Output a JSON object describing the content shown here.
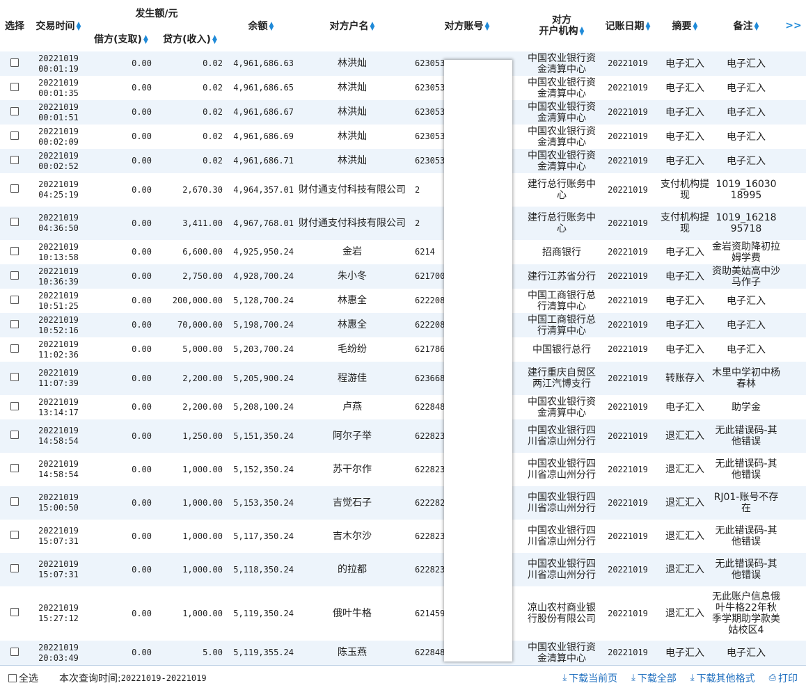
{
  "header": {
    "select": "选择",
    "time": "交易时间",
    "amount_group": "发生额/元",
    "debit": "借方(支取)",
    "credit": "贷方(收入)",
    "balance": "余额",
    "name": "对方户名",
    "account": "对方账号",
    "bank_line1": "对方",
    "bank_line2": "开户机构",
    "date": "记账日期",
    "summary": "摘要",
    "remark": "备注",
    "more": ">>"
  },
  "rows": [
    {
      "date": "20221019",
      "time": "00:01:19",
      "debit": "0.00",
      "credit": "0.02",
      "balance": "4,961,686.63",
      "name": "林洪灿",
      "account": "623053",
      "bank": "中国农业银行资金清算中心",
      "post_date": "20221019",
      "summary": "电子汇入",
      "remark": "电子汇入"
    },
    {
      "date": "20221019",
      "time": "00:01:35",
      "debit": "0.00",
      "credit": "0.02",
      "balance": "4,961,686.65",
      "name": "林洪灿",
      "account": "623053",
      "bank": "中国农业银行资金清算中心",
      "post_date": "20221019",
      "summary": "电子汇入",
      "remark": "电子汇入"
    },
    {
      "date": "20221019",
      "time": "00:01:51",
      "debit": "0.00",
      "credit": "0.02",
      "balance": "4,961,686.67",
      "name": "林洪灿",
      "account": "623053",
      "bank": "中国农业银行资金清算中心",
      "post_date": "20221019",
      "summary": "电子汇入",
      "remark": "电子汇入"
    },
    {
      "date": "20221019",
      "time": "00:02:09",
      "debit": "0.00",
      "credit": "0.02",
      "balance": "4,961,686.69",
      "name": "林洪灿",
      "account": "623053",
      "bank": "中国农业银行资金清算中心",
      "post_date": "20221019",
      "summary": "电子汇入",
      "remark": "电子汇入"
    },
    {
      "date": "20221019",
      "time": "00:02:52",
      "debit": "0.00",
      "credit": "0.02",
      "balance": "4,961,686.71",
      "name": "林洪灿",
      "account": "623053",
      "bank": "中国农业银行资金清算中心",
      "post_date": "20221019",
      "summary": "电子汇入",
      "remark": "电子汇入"
    },
    {
      "date": "20221019",
      "time": "04:25:19",
      "debit": "0.00",
      "credit": "2,670.30",
      "balance": "4,964,357.01",
      "name": "财付通支付科技有限公司",
      "account": "2",
      "bank": "建行总行账务中心",
      "post_date": "20221019",
      "summary": "支付机构提现",
      "remark": "1019_16030 18995"
    },
    {
      "date": "20221019",
      "time": "04:36:50",
      "debit": "0.00",
      "credit": "3,411.00",
      "balance": "4,967,768.01",
      "name": "财付通支付科技有限公司",
      "account": "2",
      "bank": "建行总行账务中心",
      "post_date": "20221019",
      "summary": "支付机构提现",
      "remark": "1019_16218 95718"
    },
    {
      "date": "20221019",
      "time": "10:13:58",
      "debit": "0.00",
      "credit": "6,600.00",
      "balance": "4,925,950.24",
      "name": "金岩",
      "account": "6214",
      "bank": "招商银行",
      "post_date": "20221019",
      "summary": "电子汇入",
      "remark": "金岩资助降初拉姆学费"
    },
    {
      "date": "20221019",
      "time": "10:36:39",
      "debit": "0.00",
      "credit": "2,750.00",
      "balance": "4,928,700.24",
      "name": "朱小冬",
      "account": "621700",
      "bank": "建行江苏省分行",
      "post_date": "20221019",
      "summary": "电子汇入",
      "remark": "资助美姑高中沙马作子"
    },
    {
      "date": "20221019",
      "time": "10:51:25",
      "debit": "0.00",
      "credit": "200,000.00",
      "balance": "5,128,700.24",
      "name": "林惠全",
      "account": "622208",
      "bank": "中国工商银行总行清算中心",
      "post_date": "20221019",
      "summary": "电子汇入",
      "remark": "电子汇入"
    },
    {
      "date": "20221019",
      "time": "10:52:16",
      "debit": "0.00",
      "credit": "70,000.00",
      "balance": "5,198,700.24",
      "name": "林惠全",
      "account": "622208",
      "bank": "中国工商银行总行清算中心",
      "post_date": "20221019",
      "summary": "电子汇入",
      "remark": "电子汇入"
    },
    {
      "date": "20221019",
      "time": "11:02:36",
      "debit": "0.00",
      "credit": "5,000.00",
      "balance": "5,203,700.24",
      "name": "毛纷纷",
      "account": "621786",
      "bank": "中国银行总行",
      "post_date": "20221019",
      "summary": "电子汇入",
      "remark": "电子汇入"
    },
    {
      "date": "20221019",
      "time": "11:07:39",
      "debit": "0.00",
      "credit": "2,200.00",
      "balance": "5,205,900.24",
      "name": "程游佳",
      "account": "623668",
      "bank": "建行重庆自贸区两江汽博支行",
      "post_date": "20221019",
      "summary": "转账存入",
      "remark": "木里中学初中杨春林"
    },
    {
      "date": "20221019",
      "time": "13:14:17",
      "debit": "0.00",
      "credit": "2,200.00",
      "balance": "5,208,100.24",
      "name": "卢燕",
      "account": "622848",
      "bank": "中国农业银行资金清算中心",
      "post_date": "20221019",
      "summary": "电子汇入",
      "remark": "助学金"
    },
    {
      "date": "20221019",
      "time": "14:58:54",
      "debit": "0.00",
      "credit": "1,250.00",
      "balance": "5,151,350.24",
      "name": "阿尔子举",
      "account": "622823",
      "bank": "中国农业银行四川省凉山州分行",
      "post_date": "20221019",
      "summary": "退汇汇入",
      "remark": "无此错误码-其他错误"
    },
    {
      "date": "20221019",
      "time": "14:58:54",
      "debit": "0.00",
      "credit": "1,000.00",
      "balance": "5,152,350.24",
      "name": "苏干尔作",
      "account": "622823",
      "bank": "中国农业银行四川省凉山州分行",
      "post_date": "20221019",
      "summary": "退汇汇入",
      "remark": "无此错误码-其他错误"
    },
    {
      "date": "20221019",
      "time": "15:00:50",
      "debit": "0.00",
      "credit": "1,000.00",
      "balance": "5,153,350.24",
      "name": "吉觉石子",
      "account": "622282",
      "bank": "中国农业银行四川省凉山州分行",
      "post_date": "20221019",
      "summary": "退汇汇入",
      "remark": "RJ01-账号不存在"
    },
    {
      "date": "20221019",
      "time": "15:07:31",
      "debit": "0.00",
      "credit": "1,000.00",
      "balance": "5,117,350.24",
      "name": "吉木尔沙",
      "account": "622823",
      "bank": "中国农业银行四川省凉山州分行",
      "post_date": "20221019",
      "summary": "退汇汇入",
      "remark": "无此错误码-其他错误"
    },
    {
      "date": "20221019",
      "time": "15:07:31",
      "debit": "0.00",
      "credit": "1,000.00",
      "balance": "5,118,350.24",
      "name": "的拉都",
      "account": "622823",
      "bank": "中国农业银行四川省凉山州分行",
      "post_date": "20221019",
      "summary": "退汇汇入",
      "remark": "无此错误码-其他错误"
    },
    {
      "date": "20221019",
      "time": "15:27:12",
      "debit": "0.00",
      "credit": "1,000.00",
      "balance": "5,119,350.24",
      "name": "俄叶牛格",
      "account": "621459",
      "bank": "凉山农村商业银行股份有限公司",
      "post_date": "20221019",
      "summary": "退汇汇入",
      "remark": "无此账户信息俄叶牛格22年秋季学期助学款美姑校区4"
    },
    {
      "date": "20221019",
      "time": "20:03:49",
      "debit": "0.00",
      "credit": "5.00",
      "balance": "5,119,355.24",
      "name": "陈玉燕",
      "account": "622848",
      "bank": "中国农业银行资金清算中心",
      "post_date": "20221019",
      "summary": "电子汇入",
      "remark": "电子汇入"
    }
  ],
  "footer": {
    "select_all": "全选",
    "query_label": "本次查询时间:",
    "query_value": "20221019-20221019",
    "download_page": "下载当前页",
    "download_all": "下载全部",
    "download_other": "下载其他格式",
    "print": "打印"
  },
  "colors": {
    "accent": "#1f8ad8",
    "link": "#1f6fbf",
    "row_alt": "#edf4fb"
  }
}
